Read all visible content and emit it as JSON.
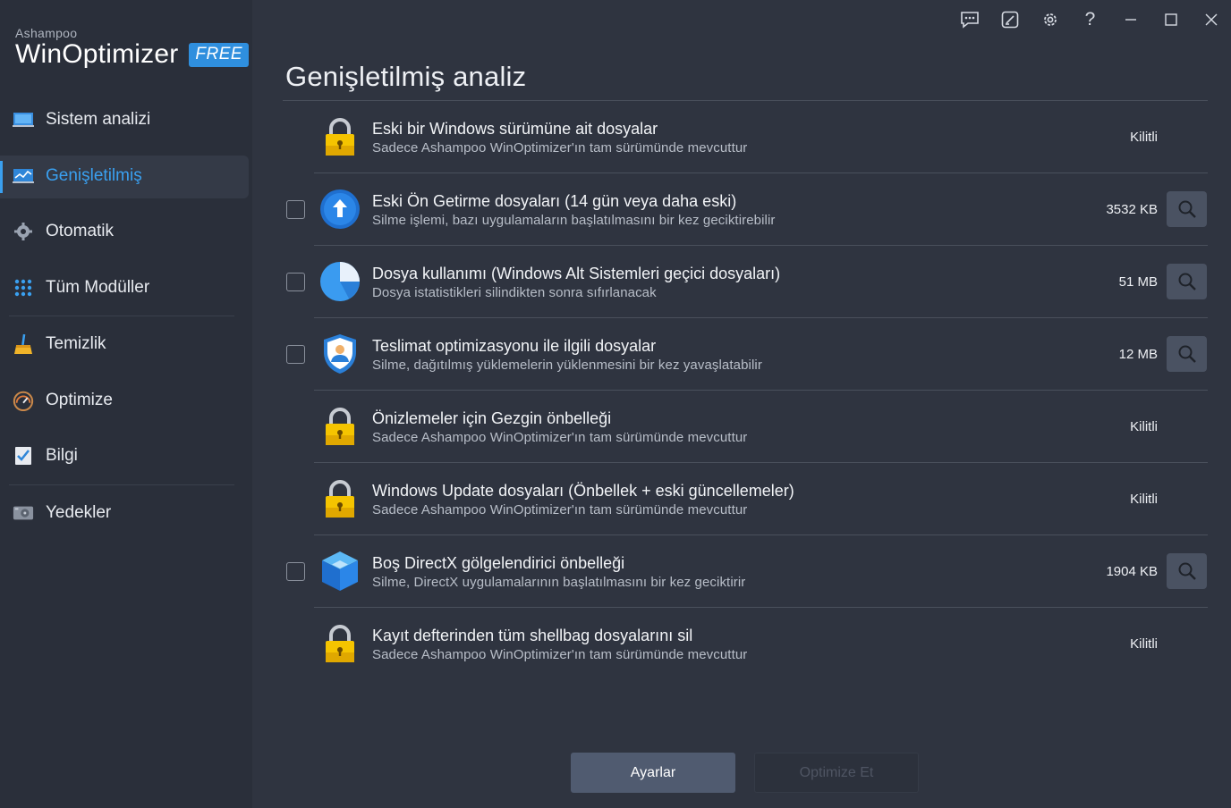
{
  "brand": {
    "small": "Ashampoo",
    "name_a": "Win",
    "name_b": "Optimizer",
    "badge": "FREE"
  },
  "nav": [
    {
      "id": "sistem",
      "label": "Sistem analizi",
      "icon": "monitor-icon",
      "active": false
    },
    {
      "id": "genis",
      "label": "Genişletilmiş",
      "icon": "chart-monitor-icon",
      "active": true
    },
    {
      "id": "otomatik",
      "label": "Otomatik",
      "icon": "gear-puzzle-icon",
      "active": false
    },
    {
      "id": "moduller",
      "label": "Tüm Modüller",
      "icon": "grid-icon",
      "active": false
    },
    {
      "id": "temizlik",
      "label": "Temizlik",
      "icon": "broom-icon",
      "active": false
    },
    {
      "id": "optimize",
      "label": "Optimize",
      "icon": "gauge-icon",
      "active": false
    },
    {
      "id": "bilgi",
      "label": "Bilgi",
      "icon": "checklist-icon",
      "active": false
    },
    {
      "id": "yedekler",
      "label": "Yedekler",
      "icon": "drive-icon",
      "active": false
    }
  ],
  "window_controls": [
    "feedback-icon",
    "edit-icon",
    "gear-icon",
    "help-icon",
    "minimize-icon",
    "maximize-icon",
    "close-icon"
  ],
  "page_title": "Genişletilmiş analiz",
  "items": [
    {
      "title": "Eski bir Windows sürümüne ait dosyalar",
      "sub": "Sadece Ashampoo WinOptimizer'ın tam sürümünde mevcuttur",
      "size": "Kilitli",
      "locked": true,
      "icon": "lock-icon"
    },
    {
      "title": "Eski Ön Getirme dosyaları (14 gün veya daha eski)",
      "sub": "Silme işlemi, bazı uygulamaların başlatılmasını bir kez geciktirebilir",
      "size": "3532 KB",
      "locked": false,
      "icon": "arrow-up-circle-icon"
    },
    {
      "title": "Dosya kullanımı (Windows Alt Sistemleri geçici dosyaları)",
      "sub": "Dosya istatistikleri silindikten sonra sıfırlanacak",
      "size": "51 MB",
      "locked": false,
      "icon": "pie-chart-icon"
    },
    {
      "title": "Teslimat optimizasyonu ile ilgili dosyalar",
      "sub": "Silme, dağıtılmış yüklemelerin yüklenmesini bir kez yavaşlatabilir",
      "size": "12 MB",
      "locked": false,
      "icon": "shield-user-icon"
    },
    {
      "title": "Önizlemeler için Gezgin önbelleği",
      "sub": "Sadece Ashampoo WinOptimizer'ın tam sürümünde mevcuttur",
      "size": "Kilitli",
      "locked": true,
      "icon": "lock-icon"
    },
    {
      "title": "Windows Update dosyaları (Önbellek + eski güncellemeler)",
      "sub": "Sadece Ashampoo WinOptimizer'ın tam sürümünde mevcuttur",
      "size": "Kilitli",
      "locked": true,
      "icon": "lock-icon"
    },
    {
      "title": "Boş DirectX gölgelendirici önbelleği",
      "sub": "Silme, DirectX uygulamalarının başlatılmasını bir kez geciktirir",
      "size": "1904 KB",
      "locked": false,
      "icon": "cube-icon"
    },
    {
      "title": "Kayıt defterinden tüm shellbag dosyalarını sil",
      "sub": "Sadece Ashampoo WinOptimizer'ın tam sürümünde mevcuttur",
      "size": "Kilitli",
      "locked": true,
      "icon": "lock-icon"
    }
  ],
  "buttons": {
    "settings": "Ayarlar",
    "optimize": "Optimize Et"
  },
  "colors": {
    "accent": "#3aa0f0",
    "badge": "#2f8fde",
    "bg": "#2f3440",
    "sidebar": "#2a2f3a"
  }
}
